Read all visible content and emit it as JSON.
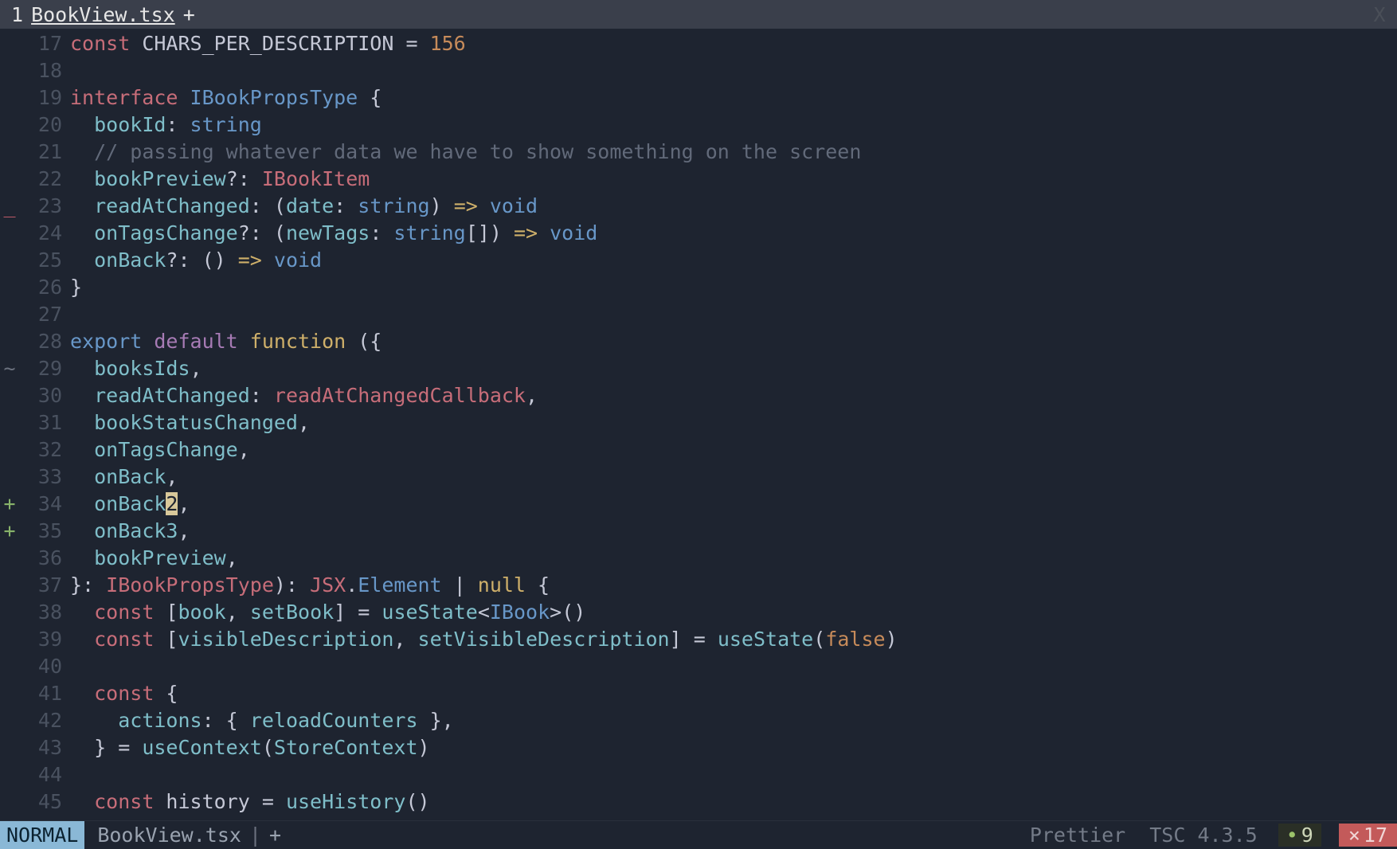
{
  "tabbar": {
    "index": "1",
    "filename": "BookView.tsx",
    "modified_indicator": "+",
    "close_label": "X"
  },
  "code": {
    "first_line_number": 17,
    "cursor": {
      "row_index": 17,
      "col_char": "2"
    },
    "gutter_signs": {
      "6": "_",
      "12": "~",
      "17": "+",
      "18": "+"
    },
    "lines": [
      [
        {
          "t": "const ",
          "c": "c-red"
        },
        {
          "t": "CHARS_PER_DESCRIPTION ",
          "c": "c-fg"
        },
        {
          "t": "= ",
          "c": "c-punct"
        },
        {
          "t": "156",
          "c": "c-orange"
        }
      ],
      [],
      [
        {
          "t": "interface ",
          "c": "c-red"
        },
        {
          "t": "IBookPropsType ",
          "c": "c-blue"
        },
        {
          "t": "{",
          "c": "c-punct"
        }
      ],
      [
        {
          "t": "  ",
          "c": "c-fg"
        },
        {
          "t": "bookId",
          "c": "c-cyan"
        },
        {
          "t": ": ",
          "c": "c-punct"
        },
        {
          "t": "string",
          "c": "c-blue"
        }
      ],
      [
        {
          "t": "  ",
          "c": "c-fg"
        },
        {
          "t": "// passing whatever data we have to show something on the screen",
          "c": "c-comment"
        }
      ],
      [
        {
          "t": "  ",
          "c": "c-fg"
        },
        {
          "t": "bookPreview",
          "c": "c-cyan"
        },
        {
          "t": "?: ",
          "c": "c-punct"
        },
        {
          "t": "IBookItem",
          "c": "c-type"
        }
      ],
      [
        {
          "t": "  ",
          "c": "c-fg"
        },
        {
          "t": "readAtChanged",
          "c": "c-cyan"
        },
        {
          "t": ": (",
          "c": "c-punct"
        },
        {
          "t": "date",
          "c": "c-cyan"
        },
        {
          "t": ": ",
          "c": "c-punct"
        },
        {
          "t": "string",
          "c": "c-blue"
        },
        {
          "t": ") ",
          "c": "c-punct"
        },
        {
          "t": "=> ",
          "c": "c-yellow"
        },
        {
          "t": "void",
          "c": "c-blue"
        }
      ],
      [
        {
          "t": "  ",
          "c": "c-fg"
        },
        {
          "t": "onTagsChange",
          "c": "c-cyan"
        },
        {
          "t": "?: (",
          "c": "c-punct"
        },
        {
          "t": "newTags",
          "c": "c-cyan"
        },
        {
          "t": ": ",
          "c": "c-punct"
        },
        {
          "t": "string",
          "c": "c-blue"
        },
        {
          "t": "[]) ",
          "c": "c-punct"
        },
        {
          "t": "=> ",
          "c": "c-yellow"
        },
        {
          "t": "void",
          "c": "c-blue"
        }
      ],
      [
        {
          "t": "  ",
          "c": "c-fg"
        },
        {
          "t": "onBack",
          "c": "c-cyan"
        },
        {
          "t": "?: () ",
          "c": "c-punct"
        },
        {
          "t": "=> ",
          "c": "c-yellow"
        },
        {
          "t": "void",
          "c": "c-blue"
        }
      ],
      [
        {
          "t": "}",
          "c": "c-punct"
        }
      ],
      [],
      [
        {
          "t": "export ",
          "c": "c-blue"
        },
        {
          "t": "default ",
          "c": "c-purple"
        },
        {
          "t": "function ",
          "c": "c-yellow"
        },
        {
          "t": "({",
          "c": "c-punct"
        }
      ],
      [
        {
          "t": "  ",
          "c": "c-fg"
        },
        {
          "t": "booksIds",
          "c": "c-cyan"
        },
        {
          "t": ",",
          "c": "c-punct"
        }
      ],
      [
        {
          "t": "  ",
          "c": "c-fg"
        },
        {
          "t": "readAtChanged",
          "c": "c-cyan"
        },
        {
          "t": ": ",
          "c": "c-punct"
        },
        {
          "t": "readAtChangedCallback",
          "c": "c-type"
        },
        {
          "t": ",",
          "c": "c-punct"
        }
      ],
      [
        {
          "t": "  ",
          "c": "c-fg"
        },
        {
          "t": "bookStatusChanged",
          "c": "c-cyan"
        },
        {
          "t": ",",
          "c": "c-punct"
        }
      ],
      [
        {
          "t": "  ",
          "c": "c-fg"
        },
        {
          "t": "onTagsChange",
          "c": "c-cyan"
        },
        {
          "t": ",",
          "c": "c-punct"
        }
      ],
      [
        {
          "t": "  ",
          "c": "c-fg"
        },
        {
          "t": "onBack",
          "c": "c-cyan"
        },
        {
          "t": ",",
          "c": "c-punct"
        }
      ],
      [
        {
          "t": "  ",
          "c": "c-fg"
        },
        {
          "t": "onBack",
          "c": "c-cyan"
        },
        {
          "t": "2",
          "c": "cursor-cell"
        },
        {
          "t": ",",
          "c": "c-punct"
        }
      ],
      [
        {
          "t": "  ",
          "c": "c-fg"
        },
        {
          "t": "onBack3",
          "c": "c-cyan"
        },
        {
          "t": ",",
          "c": "c-punct"
        }
      ],
      [
        {
          "t": "  ",
          "c": "c-fg"
        },
        {
          "t": "bookPreview",
          "c": "c-cyan"
        },
        {
          "t": ",",
          "c": "c-punct"
        }
      ],
      [
        {
          "t": "}: ",
          "c": "c-punct"
        },
        {
          "t": "IBookPropsType",
          "c": "c-type"
        },
        {
          "t": "): ",
          "c": "c-punct"
        },
        {
          "t": "JSX",
          "c": "c-type"
        },
        {
          "t": ".",
          "c": "c-punct"
        },
        {
          "t": "Element ",
          "c": "c-blue"
        },
        {
          "t": "| ",
          "c": "c-punct"
        },
        {
          "t": "null ",
          "c": "c-yellow"
        },
        {
          "t": "{",
          "c": "c-punct"
        }
      ],
      [
        {
          "t": "  ",
          "c": "c-fg"
        },
        {
          "t": "const ",
          "c": "c-red"
        },
        {
          "t": "[",
          "c": "c-punct"
        },
        {
          "t": "book",
          "c": "c-cyan"
        },
        {
          "t": ", ",
          "c": "c-punct"
        },
        {
          "t": "setBook",
          "c": "c-cyan"
        },
        {
          "t": "] = ",
          "c": "c-punct"
        },
        {
          "t": "useState",
          "c": "c-cyan"
        },
        {
          "t": "<",
          "c": "c-punct"
        },
        {
          "t": "IBook",
          "c": "c-blue"
        },
        {
          "t": ">()",
          "c": "c-punct"
        }
      ],
      [
        {
          "t": "  ",
          "c": "c-fg"
        },
        {
          "t": "const ",
          "c": "c-red"
        },
        {
          "t": "[",
          "c": "c-punct"
        },
        {
          "t": "visibleDescription",
          "c": "c-cyan"
        },
        {
          "t": ", ",
          "c": "c-punct"
        },
        {
          "t": "setVisibleDescription",
          "c": "c-cyan"
        },
        {
          "t": "] = ",
          "c": "c-punct"
        },
        {
          "t": "useState",
          "c": "c-cyan"
        },
        {
          "t": "(",
          "c": "c-punct"
        },
        {
          "t": "false",
          "c": "c-orange"
        },
        {
          "t": ")",
          "c": "c-punct"
        }
      ],
      [],
      [
        {
          "t": "  ",
          "c": "c-fg"
        },
        {
          "t": "const ",
          "c": "c-red"
        },
        {
          "t": "{",
          "c": "c-punct"
        }
      ],
      [
        {
          "t": "    ",
          "c": "c-fg"
        },
        {
          "t": "actions",
          "c": "c-cyan"
        },
        {
          "t": ": { ",
          "c": "c-punct"
        },
        {
          "t": "reloadCounters ",
          "c": "c-cyan"
        },
        {
          "t": "},",
          "c": "c-punct"
        }
      ],
      [
        {
          "t": "  ",
          "c": "c-fg"
        },
        {
          "t": "} = ",
          "c": "c-punct"
        },
        {
          "t": "useContext",
          "c": "c-cyan"
        },
        {
          "t": "(",
          "c": "c-punct"
        },
        {
          "t": "StoreContext",
          "c": "c-cyan"
        },
        {
          "t": ")",
          "c": "c-punct"
        }
      ],
      [],
      [
        {
          "t": "  ",
          "c": "c-fg"
        },
        {
          "t": "const ",
          "c": "c-red"
        },
        {
          "t": "history ",
          "c": "c-fg"
        },
        {
          "t": "= ",
          "c": "c-punct"
        },
        {
          "t": "useHistory",
          "c": "c-cyan"
        },
        {
          "t": "()",
          "c": "c-punct"
        }
      ]
    ]
  },
  "statusbar": {
    "mode": "NORMAL",
    "filename": "BookView.tsx",
    "modified_indicator": "+",
    "formatter": "Prettier",
    "tsc_label": "TSC 4.3.5",
    "warnings": "9",
    "errors": "17"
  }
}
